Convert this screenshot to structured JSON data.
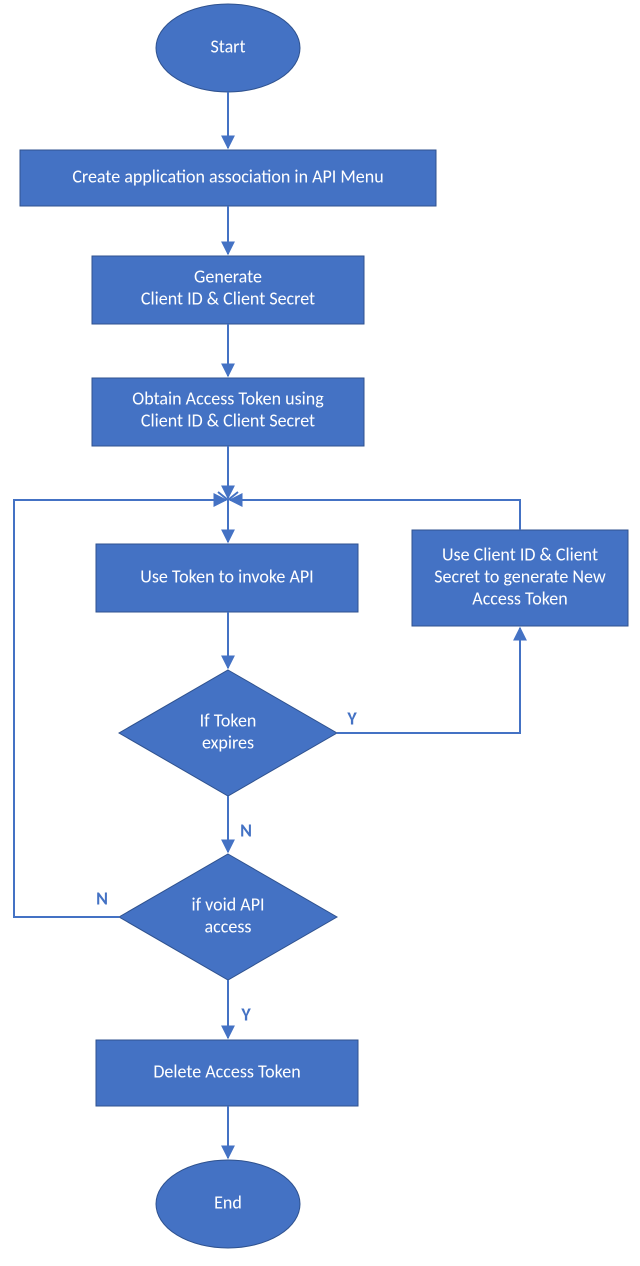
{
  "flow": {
    "start": "Start",
    "end": "End",
    "step1": "Create application association in API Menu",
    "step2_line1": "Generate",
    "step2_line2": "Client ID & Client Secret",
    "step3_line1": "Obtain Access Token using",
    "step3_line2": "Client ID & Client Secret",
    "step4": "Use Token to invoke API",
    "step5_line1": "Use Client ID & Client",
    "step5_line2": "Secret to generate New",
    "step5_line3": "Access Token",
    "dec1_line1": "If Token",
    "dec1_line2": "expires",
    "dec2_line1": "if void API",
    "dec2_line2": "access",
    "step6": "Delete Access Token",
    "yes": "Y",
    "no": "N"
  }
}
